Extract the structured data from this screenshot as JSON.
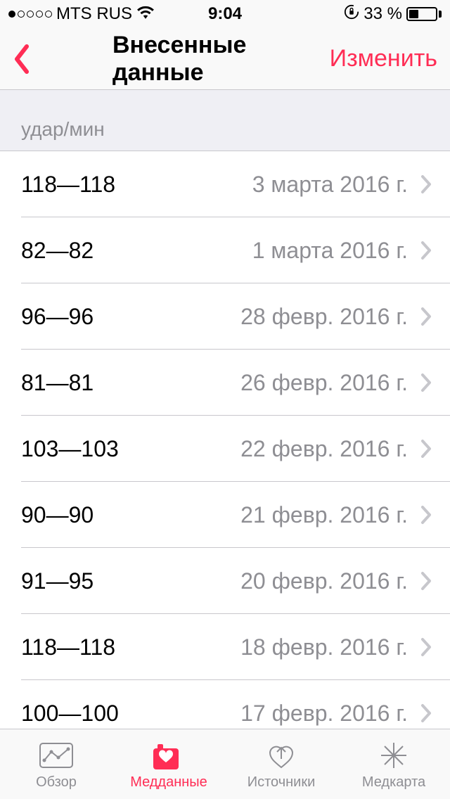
{
  "status_bar": {
    "carrier": "MTS RUS",
    "time": "9:04",
    "battery_pct": "33 %"
  },
  "nav": {
    "title": "Внесенные данные",
    "edit": "Изменить"
  },
  "section_header": "удар/мин",
  "rows": [
    {
      "value": "118—118",
      "date": "3 марта 2016 г."
    },
    {
      "value": "82—82",
      "date": "1 марта 2016 г."
    },
    {
      "value": "96—96",
      "date": "28 февр. 2016 г."
    },
    {
      "value": "81—81",
      "date": "26 февр. 2016 г."
    },
    {
      "value": "103—103",
      "date": "22 февр. 2016 г."
    },
    {
      "value": "90—90",
      "date": "21 февр. 2016 г."
    },
    {
      "value": "91—95",
      "date": "20 февр. 2016 г."
    },
    {
      "value": "118—118",
      "date": "18 февр. 2016 г."
    },
    {
      "value": "100—100",
      "date": "17 февр. 2016 г."
    }
  ],
  "tabs": [
    {
      "label": "Обзор"
    },
    {
      "label": "Медданные"
    },
    {
      "label": "Источники"
    },
    {
      "label": "Медкарта"
    }
  ],
  "colors": {
    "accent": "#ff2d55",
    "secondary": "#8e8e93"
  }
}
